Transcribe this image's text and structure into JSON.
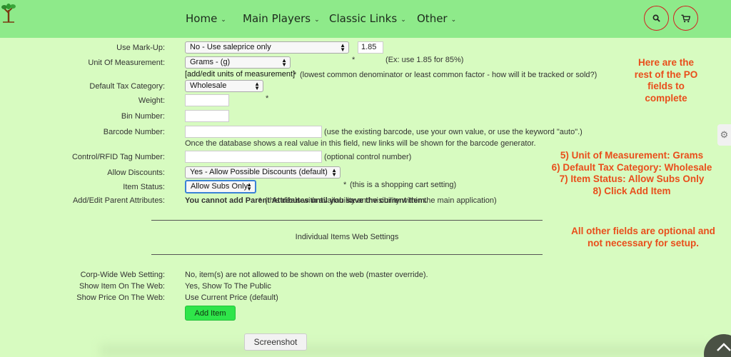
{
  "nav": {
    "home": "Home",
    "main_players": "Main Players",
    "classic_links": "Classic Links",
    "other": "Other",
    "search_icon": "search-icon",
    "cart_icon": "cart-icon"
  },
  "form": {
    "markup": {
      "label": "Use Mark-Up:",
      "select": "No - Use saleprice only",
      "value": "1.85",
      "hint": "(Ex: use 1.85 for 85%)"
    },
    "uom": {
      "label": "Unit Of Measurement:",
      "select": "Grams - (g)",
      "hint": "(lowest common denominator or least common factor - how will it be tracked or sold?)",
      "link": "[add/edit units of measurement]"
    },
    "tax": {
      "label": "Default Tax Category:",
      "select": "Wholesale"
    },
    "weight": {
      "label": "Weight:"
    },
    "bin": {
      "label": "Bin Number:"
    },
    "barcode": {
      "label": "Barcode Number:",
      "hint": "(use the existing barcode, use your own value, or use the keyword \"auto\".)",
      "note": "Once the database shows a real value in this field, new links will be shown for the barcode generator."
    },
    "control": {
      "label": "Control/RFID Tag Number:",
      "hint": "(optional control number)"
    },
    "discounts": {
      "label": "Allow Discounts:",
      "select": "Yes - Allow Possible Discounts (default)",
      "hint": "(this is a shopping cart setting)"
    },
    "status": {
      "label": "Item Status:",
      "select": "Allow Subs Only",
      "hint": "(this deals with availability and visibility within the main application)"
    },
    "parent": {
      "label": "Add/Edit Parent Attributes:",
      "value": "You cannot add Parent Attributes until you save the current Item."
    },
    "required_mark": "*",
    "web_section_title": "Individual Items Web Settings",
    "corp_web": {
      "label": "Corp-Wide Web Setting:",
      "value": "No, item(s) are not allowed to be shown on the web (master override)."
    },
    "show_item": {
      "label": "Show Item On The Web:",
      "value": "Yes, Show To The Public"
    },
    "show_price": {
      "label": "Show Price On The Web:",
      "value": "Use Current Price (default)"
    },
    "add_button": "Add Item"
  },
  "annotations": {
    "a1": [
      "Here are the",
      "rest of the PO",
      "fields to",
      "complete"
    ],
    "a2": [
      "5) Unit of Measurement: Grams",
      "6) Default Tax Category: Wholesale",
      "7) Item Status: Allow Subs Only",
      "8) Click Add Item"
    ],
    "a3": [
      "All other fields are optional and",
      "not necessary for setup."
    ]
  },
  "screenshot_tab": "Screenshot",
  "colors": {
    "nav_bg": "#8eea8a",
    "page_bg": "#d7fbc0",
    "annotation": "#e94e1b",
    "add_button": "#2fe54a",
    "circle_border": "#d32020"
  }
}
